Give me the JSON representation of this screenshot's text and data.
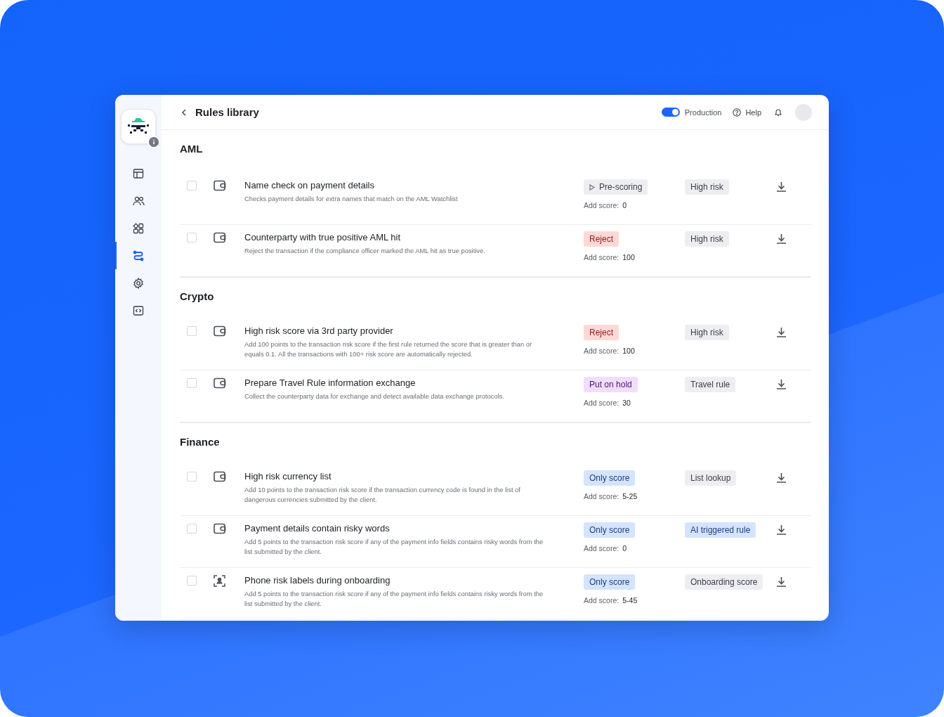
{
  "window": {
    "title": "Rules library"
  },
  "header": {
    "toggle": {
      "label": "Production",
      "on": true
    },
    "help": "Help"
  },
  "sidebar": {
    "items": [
      {
        "kind": "layout",
        "selected": false
      },
      {
        "kind": "users",
        "selected": false
      },
      {
        "kind": "apps",
        "selected": false
      },
      {
        "kind": "flow",
        "selected": true
      },
      {
        "kind": "settings",
        "selected": false
      },
      {
        "kind": "code",
        "selected": false
      }
    ]
  },
  "sections": [
    {
      "title": "AML",
      "rules": [
        {
          "checked": false,
          "kind": "wallet",
          "title": "Name check on payment details",
          "description": "Checks payment details for extra names that match on the AML Watchlist",
          "action": {
            "kind": "prescoring",
            "label": "Pre-scoring"
          },
          "score_label": "Add score:",
          "score": "0",
          "tag": {
            "kind": "neutral",
            "label": "High risk"
          }
        },
        {
          "checked": false,
          "kind": "wallet",
          "title": "Counterparty with true positive AML hit",
          "description": "Reject the transaction if the compliance officer marked the AML hit as true positive.",
          "action": {
            "kind": "reject",
            "label": "Reject"
          },
          "score_label": "Add score:",
          "score": "100",
          "tag": {
            "kind": "neutral",
            "label": "High risk"
          }
        }
      ]
    },
    {
      "title": "Crypto",
      "rules": [
        {
          "checked": false,
          "kind": "wallet",
          "title": "High risk score via 3rd party provider",
          "description": "Add 100 points to the transaction risk score if the first rule returned the score that is greater than or equals 0.1. All the transactions with 100+ risk score are automatically rejected.",
          "action": {
            "kind": "reject",
            "label": "Reject"
          },
          "score_label": "Add score:",
          "score": "100",
          "tag": {
            "kind": "neutral",
            "label": "High risk"
          }
        },
        {
          "checked": false,
          "kind": "wallet",
          "title": "Prepare Travel Rule information exchange",
          "description": "Collect the counterparty data for exchange and detect available data exchange protocols.",
          "action": {
            "kind": "hold",
            "label": "Put on hold"
          },
          "score_label": "Add score:",
          "score": "30",
          "tag": {
            "kind": "neutral",
            "label": "Travel rule"
          }
        }
      ]
    },
    {
      "title": "Finance",
      "rules": [
        {
          "checked": false,
          "kind": "wallet",
          "title": "High risk currency list",
          "description": "Add 10 points to the transaction risk score if the transaction currency code is found in the list of dangerous currencies submitted by the client.",
          "action": {
            "kind": "score",
            "label": "Only score"
          },
          "score_label": "Add score:",
          "score": "5-25",
          "tag": {
            "kind": "neutral",
            "label": "List lookup"
          }
        },
        {
          "checked": false,
          "kind": "wallet",
          "title": "Payment details contain risky words",
          "description": "Add 5 points to the transaction risk score if any of the payment info fields contains risky words from the list submitted by the client.",
          "action": {
            "kind": "score",
            "label": "Only score"
          },
          "score_label": "Add score:",
          "score": "0",
          "tag": {
            "kind": "ai",
            "label": "AI triggered rule"
          }
        },
        {
          "checked": false,
          "kind": "face",
          "title": "Phone risk labels during onboarding",
          "description": "Add 5 points to the transaction risk score if any of the payment info fields contains risky words from the list submitted by the client.",
          "action": {
            "kind": "score",
            "label": "Only score"
          },
          "score_label": "Add score:",
          "score": "5-45",
          "tag": {
            "kind": "neutral",
            "label": "Onboarding score"
          }
        }
      ]
    }
  ]
}
